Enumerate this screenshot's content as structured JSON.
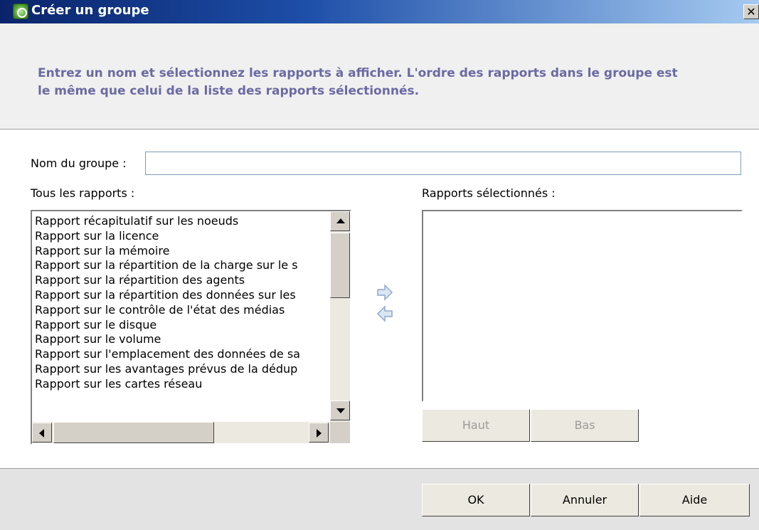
{
  "window": {
    "title": "Créer un groupe",
    "close_label": "✕"
  },
  "header": {
    "instruction_line1": "Entrez un nom et sélectionnez les rapports à afficher. L'ordre des rapports dans le groupe est",
    "instruction_line2": "le même que celui de la liste des rapports sélectionnés."
  },
  "form": {
    "group_name_label": "Nom du groupe :",
    "group_name_value": "",
    "all_reports_label": "Tous les rapports :",
    "selected_reports_label": "Rapports sélectionnés :"
  },
  "all_reports": [
    "Rapport récapitulatif sur les noeuds",
    "Rapport sur la licence",
    "Rapport sur la mémoire",
    "Rapport sur la répartition de la charge sur le s",
    "Rapport sur la répartition des agents",
    "Rapport sur la répartition des données sur les",
    "Rapport sur le contrôle de l'état des médias",
    "Rapport sur le disque",
    "Rapport sur le volume",
    "Rapport sur l'emplacement des données de sa",
    "Rapport sur les avantages prévus de la dédup",
    "Rapport sur les cartes réseau"
  ],
  "selected_reports": [],
  "order_buttons": {
    "up_label": "Haut",
    "down_label": "Bas"
  },
  "footer_buttons": {
    "ok_label": "OK",
    "cancel_label": "Annuler",
    "help_label": "Aide"
  },
  "colors": {
    "instruction_text": "#6b6aa3",
    "titlebar_start": "#0a246a",
    "titlebar_end": "#a6caf0",
    "move_arrow": "#9fb8d8"
  }
}
